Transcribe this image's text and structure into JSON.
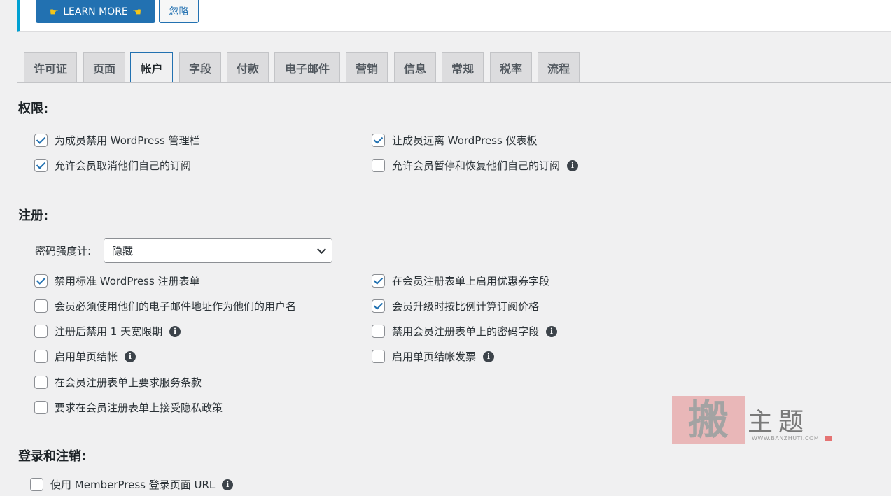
{
  "notice": {
    "learn_more": "LEARN MORE",
    "ignore": "忽略"
  },
  "tabs": [
    "许可证",
    "页面",
    "帐户",
    "字段",
    "付款",
    "电子邮件",
    "营销",
    "信息",
    "常规",
    "税率",
    "流程"
  ],
  "active_tab": "帐户",
  "permissions": {
    "title": "权限:",
    "options": [
      {
        "label": "为成员禁用 WordPress 管理栏",
        "checked": true
      },
      {
        "label": "让成员远离 WordPress 仪表板",
        "checked": true
      },
      {
        "label": "允许会员取消他们自己的订阅",
        "checked": true
      },
      {
        "label": "允许会员暂停和恢复他们自己的订阅",
        "checked": false,
        "info": true
      }
    ]
  },
  "registration": {
    "title": "注册:",
    "password_meter_label": "密码强度计:",
    "password_meter_value": "隐藏",
    "options": [
      {
        "label": "禁用标准 WordPress 注册表单",
        "checked": true
      },
      {
        "label": "在会员注册表单上启用优惠券字段",
        "checked": true
      },
      {
        "label": "会员必须使用他们的电子邮件地址作为他们的用户名",
        "checked": false
      },
      {
        "label": "会员升级时按比例计算订阅价格",
        "checked": true
      },
      {
        "label": "注册后禁用 1 天宽限期",
        "checked": false,
        "info": true
      },
      {
        "label": "禁用会员注册表单上的密码字段",
        "checked": false,
        "info": true
      },
      {
        "label": "启用单页结帐",
        "checked": false,
        "info": true
      },
      {
        "label": "启用单页结帐发票",
        "checked": false,
        "info": true
      },
      {
        "label": "在会员注册表单上要求服务条款",
        "checked": false
      },
      {
        "label": "要求在会员注册表单上接受隐私政策",
        "checked": false
      }
    ]
  },
  "login": {
    "title": "登录和注销:",
    "options": [
      {
        "label": "使用 MemberPress 登录页面 URL",
        "checked": false,
        "info": true
      }
    ]
  },
  "watermark": {
    "glyph": "搬",
    "text": "主题",
    "url": "WWW.BANZHUTI.COM"
  },
  "colors": {
    "primary": "#2271b1",
    "notice_border": "#00a0d2"
  },
  "icons": {
    "checkbox_checked": "checkmark-icon",
    "info": "info-icon",
    "select_chevron": "chevron-down-icon",
    "learn_more_hands": "pointing-hand-icon"
  }
}
